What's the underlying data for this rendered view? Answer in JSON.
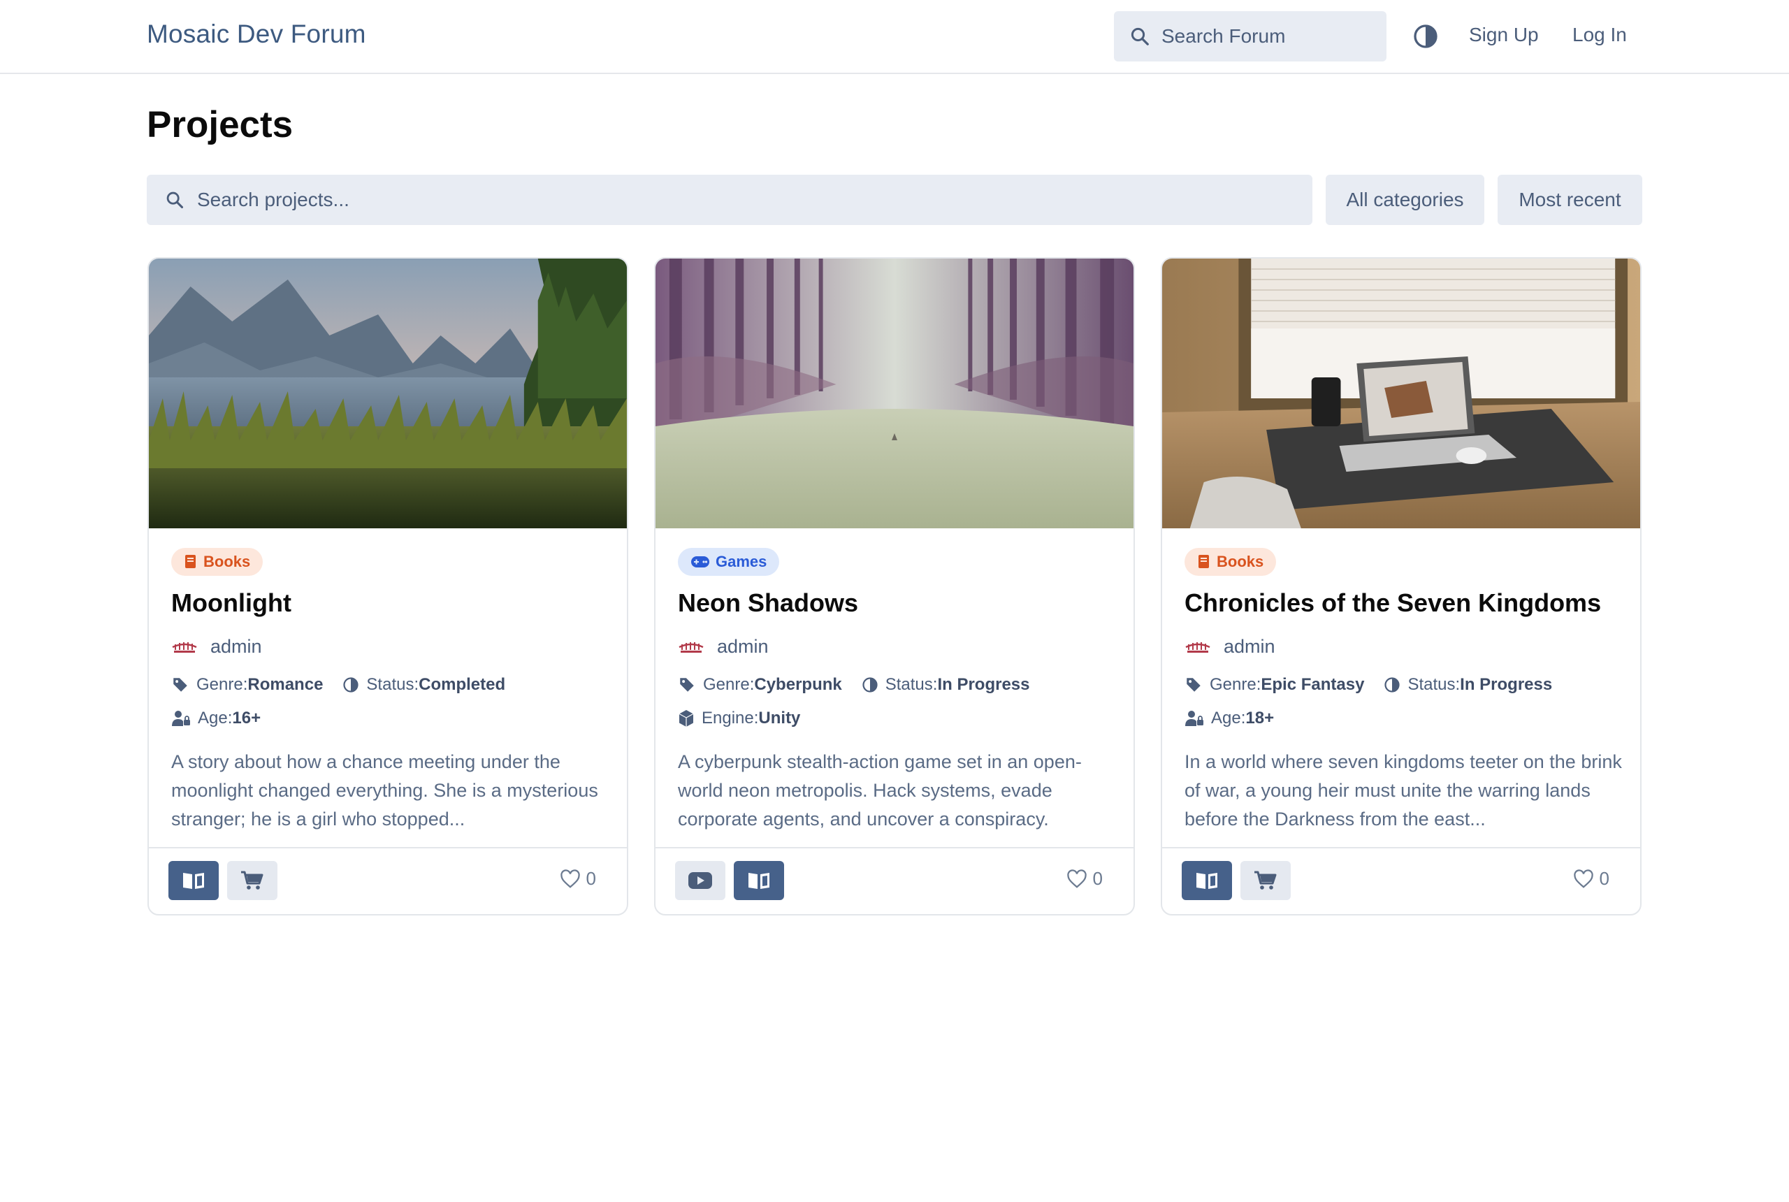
{
  "header": {
    "brand": "Mosaic Dev Forum",
    "search_placeholder": "Search Forum",
    "signup": "Sign Up",
    "login": "Log In"
  },
  "page": {
    "title": "Projects",
    "search_placeholder": "Search projects...",
    "category_filter": "All categories",
    "sort_filter": "Most recent"
  },
  "projects": [
    {
      "badge": "Books",
      "title": "Moonlight",
      "author": "admin",
      "genre_label": "Genre:",
      "genre": "Romance",
      "status_label": "Status:",
      "status": "Completed",
      "extra_label": "Age:",
      "extra": "16+",
      "description": "A story about how a chance meeting under the moonlight changed everything. She is a mysterious stranger; he is a girl who stopped...",
      "likes": "0"
    },
    {
      "badge": "Games",
      "title": "Neon Shadows",
      "author": "admin",
      "genre_label": "Genre:",
      "genre": "Cyberpunk",
      "status_label": "Status:",
      "status": "In Progress",
      "extra_label": "Engine:",
      "extra": "Unity",
      "description": "A cyberpunk stealth-action game set in an open-world neon metropolis. Hack systems, evade corporate agents, and uncover a conspiracy.",
      "likes": "0"
    },
    {
      "badge": "Books",
      "title": "Chronicles of the Seven Kingdoms",
      "author": "admin",
      "genre_label": "Genre:",
      "genre": "Epic Fantasy",
      "status_label": "Status:",
      "status": "In Progress",
      "extra_label": "Age:",
      "extra": "18+",
      "description": "In a world where seven kingdoms teeter on the brink of war, a young heir must unite the warring lands before the Darkness from the east...",
      "likes": "0"
    }
  ],
  "colors": {
    "brand": "#3d5a80",
    "books_badge": "#d9531e",
    "games_badge": "#2a5bd7",
    "primary_action": "#46618a"
  }
}
